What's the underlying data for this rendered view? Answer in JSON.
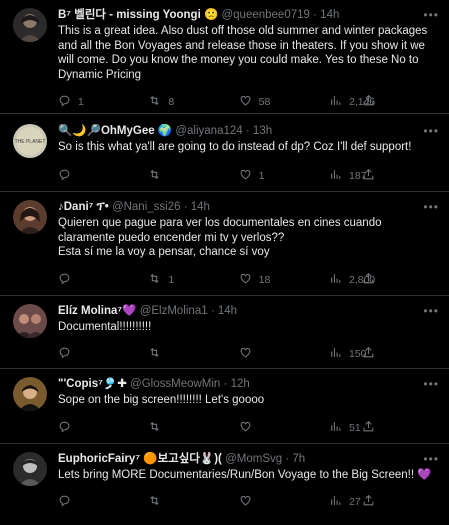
{
  "tweets": [
    {
      "name": "B⁷ 벨린다 - missing Yoongi 🙁",
      "handle": "@queenbee0719",
      "sep": "·",
      "time": "14h",
      "text": "This is a great idea. Also dust off those old summer and winter packages and all the Bon Voyages and release those in theaters. If you show it we will come. Do you know the money you could make. Yes to these No to Dynamic Pricing",
      "replies": "1",
      "retweets": "8",
      "likes": "58",
      "views": "2,146"
    },
    {
      "name": "🔍🌙🔎OhMyGee 🌍",
      "handle": "@aliyana124",
      "sep": "·",
      "time": "13h",
      "text": "So is this what ya'll are going to do instead of dp? Coz I'll def support!",
      "replies": "",
      "retweets": "",
      "likes": "1",
      "views": "187"
    },
    {
      "name": "♪Dani⁷ ፕ•",
      "handle": "@Nani_ssi26",
      "sep": "·",
      "time": "14h",
      "text": "Quieren que pague para ver los documentales en cines cuando claramente puedo encender mi tv y verlos??\nEsta sí me la voy a pensar, chance sí voy",
      "replies": "",
      "retweets": "1",
      "likes": "18",
      "views": "2,800"
    },
    {
      "name": "Elíz Molina⁷💜",
      "handle": "@ElzMolina1",
      "sep": "·",
      "time": "14h",
      "text": "Documental!!!!!!!!!!",
      "replies": "",
      "retweets": "",
      "likes": "",
      "views": "150"
    },
    {
      "name": "\"'Copis⁷🎐✚",
      "handle": "@GlossMeowMin",
      "sep": "·",
      "time": "12h",
      "text": "Sope on the big screen!!!!!!!! Let's goooo",
      "replies": "",
      "retweets": "",
      "likes": "",
      "views": "51"
    },
    {
      "name": "EuphoricFairy⁷ 🟠보고싶다🐰)(",
      "handle": "@MomSvg",
      "sep": "·",
      "time": "7h",
      "text": "Lets bring MORE Documentaries/Run/Bon Voyage to the Big Screen!! 💜",
      "replies": "",
      "retweets": "",
      "likes": "",
      "views": "27"
    }
  ],
  "icons": {
    "more": "more-icon",
    "reply": "reply-icon",
    "retweet": "retweet-icon",
    "like": "like-icon",
    "views": "views-icon",
    "share": "share-icon"
  },
  "colors": {
    "background": "#000000",
    "text": "#e7e9ea",
    "muted": "#71767b",
    "divider": "#2f3336",
    "purple_heart": "#8a4fd3"
  }
}
